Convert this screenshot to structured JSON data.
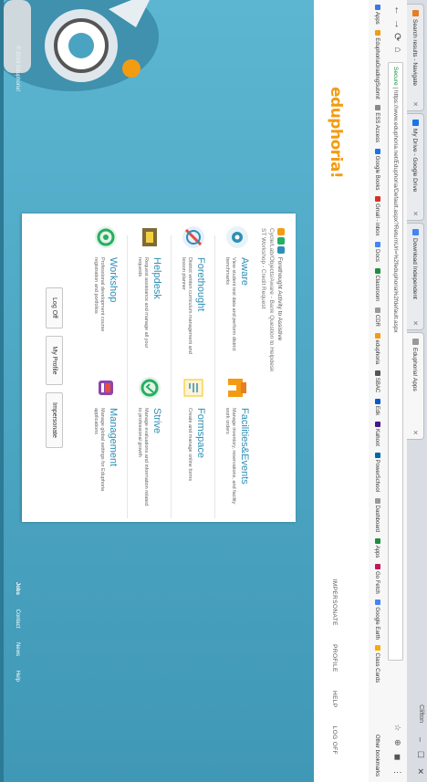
{
  "browser": {
    "tabs": [
      {
        "label": "Search results - Navigate",
        "color": "#e67e22"
      },
      {
        "label": "My Drive - Google Drive",
        "color": "#1a73e8"
      },
      {
        "label": "Download Independent",
        "color": "#4285f4"
      },
      {
        "label": "Eduphoria! Apps",
        "color": "#999999"
      }
    ],
    "window_label": "Clifton",
    "window_controls": [
      "–",
      "☐",
      "✕"
    ],
    "nav": [
      "←",
      "→",
      "⟳",
      "⌂"
    ],
    "url_secure": "Secure",
    "url": "https://www.eduphoria.net/Eduphoria/Default.aspx?ReturnUrl=%2feduphoria%2fdefault.aspx",
    "bookmarks": [
      {
        "label": "Apps",
        "color": "#3b78e7"
      },
      {
        "label": "EduphoriaGradingSubmit",
        "color": "#f39c12"
      },
      {
        "label": "ESS Access",
        "color": "#888888"
      },
      {
        "label": "Google Books",
        "color": "#1a73e8"
      },
      {
        "label": "Gmail - inbox",
        "color": "#d93025"
      },
      {
        "label": "Docs",
        "color": "#4285f4"
      },
      {
        "label": "Classroom",
        "color": "#1e8e3e"
      },
      {
        "label": "CDR",
        "color": "#999999"
      },
      {
        "label": "eduphoria",
        "color": "#f39c12"
      },
      {
        "label": "SBAC",
        "color": "#555555"
      },
      {
        "label": "Edk",
        "color": "#0b57d0"
      },
      {
        "label": "Kahoot",
        "color": "#46178f"
      },
      {
        "label": "PowerSchool",
        "color": "#0066aa"
      },
      {
        "label": "Dashboard",
        "color": "#999999"
      },
      {
        "label": "Apps",
        "color": "#1e8e3e"
      },
      {
        "label": "Go Fetch",
        "color": "#c2185b"
      },
      {
        "label": "Google Earth",
        "color": "#4285f4"
      },
      {
        "label": "Class Cards",
        "color": "#f9ab00"
      }
    ],
    "other_bookmarks": "Other bookmarks"
  },
  "app": {
    "brand": "eduphoria!",
    "topnav": [
      "IMPERSONATE",
      "PROFILE",
      "HELP",
      "LOG OFF"
    ],
    "prefs_line1": "Forethought Activity to Assistive ",
    "prefs_line2": "Cycle/Lab/Objects/Aware - Bank Question to Helpdesk",
    "prefs_line3": "ST Workshop - Credit Request",
    "apps": [
      {
        "name": "Aware",
        "desc": "View student test data and perform district benchmarks",
        "icon": "aware-icon",
        "color": "#2e8fb5"
      },
      {
        "name": "Facilities&Events",
        "desc": "Manage inventory, reservations, and facility work orders",
        "icon": "facilities-icon",
        "color": "#f39c12"
      },
      {
        "name": "Forethought",
        "desc": "District written curriculum management and lesson planner",
        "icon": "forethought-icon",
        "color": "#e74c3c"
      },
      {
        "name": "Formspace",
        "desc": "Create and manage online forms",
        "icon": "formspace-icon",
        "color": "#f1c40f"
      },
      {
        "name": "Helpdesk",
        "desc": "Request assistance and manage all your requests",
        "icon": "helpdesk-icon",
        "color": "#7f6a3b"
      },
      {
        "name": "Strive",
        "desc": "Manage evaluations and information related to professional growth",
        "icon": "strive-icon",
        "color": "#27ae60"
      },
      {
        "name": "Workshop",
        "desc": "Professional development course registration and portfolios",
        "icon": "workshop-icon",
        "color": "#27ae60"
      },
      {
        "name": "Management",
        "desc": "Manage global settings for Eduphoria applications",
        "icon": "management-icon",
        "color": "#8e44ad"
      }
    ],
    "buttons": [
      "Log Off",
      "My Profile",
      "Impersonate"
    ],
    "copyright": "© 2018 Eduphoria!",
    "footer_links": [
      "Jobs",
      "Contact",
      "News",
      "Help"
    ]
  }
}
